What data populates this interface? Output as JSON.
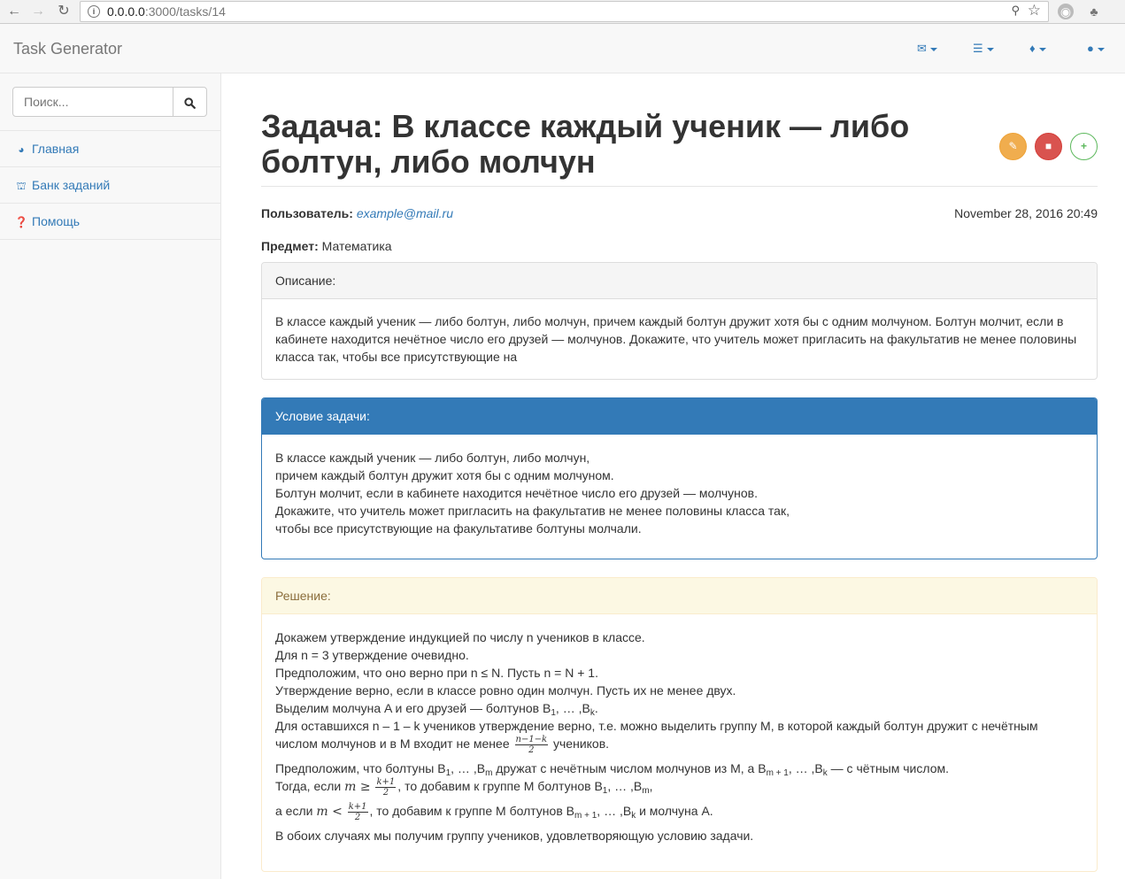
{
  "browser": {
    "url_host": "0.0.0.0",
    "url_path": ":3000/tasks/14"
  },
  "navbar": {
    "brand": "Task Generator",
    "icons": [
      "envelope-icon",
      "list-icon",
      "bell-icon",
      "user-icon"
    ]
  },
  "sidebar": {
    "search_placeholder": "Поиск...",
    "items": [
      {
        "label": "Главная",
        "icon": "dashboard-icon"
      },
      {
        "label": "Банк заданий",
        "icon": "bank-icon"
      },
      {
        "label": "Помощь",
        "icon": "question-icon"
      }
    ]
  },
  "task": {
    "title_prefix": "Задача:",
    "title": "В классе каждый ученик — либо болтун, либо молчун",
    "user_label": "Пользователь:",
    "user_email": "example@mail.ru",
    "date": "November 28, 2016 20:49",
    "subject_label": "Предмет:",
    "subject": "Математика",
    "description_header": "Описание:",
    "description": "В классе каждый ученик — либо болтун, либо молчун, причем каждый болтун дружит хотя бы с одним молчуном. Болтун молчит, если в кабинете находится нечётное число его друзей — молчунов. Докажите, что учитель может пригласить на факультатив не менее половины класса так, чтобы все присутствующие на",
    "condition_header": "Условие задачи:",
    "condition_lines": [
      "В классе каждый ученик — либо болтун, либо молчун,",
      "причем каждый болтун дружит хотя бы с одним молчуном.",
      "Болтун молчит, если в кабинете находится нечётное число его друзей — молчунов.",
      "Докажите, что учитель может пригласить на факультатив не менее половины класса так,",
      "чтобы все присутствующие на факультативе болтуны молчали."
    ],
    "solution_header": "Решение:",
    "solution": {
      "l1": "Докажем утверждение индукцией по числу n учеников в классе.",
      "l2": "Для n = 3 утверждение очевидно.",
      "l3": "Предположим, что оно верно при n ≤ N. Пусть n = N + 1.",
      "l4": "Утверждение верно, если в классе ровно один молчун. Пусть их не менее двух.",
      "l5a": "Выделим молчуна A и его друзей — болтунов B",
      "l5b": ", … ,B",
      "l5c": ".",
      "l6": "Для оставшихся n – 1 – k учеников утверждение верно, т.е. можно выделить группу M, в которой каждый болтун дружит с нечётным",
      "l7a": "числом молчунов и в M входит не менее",
      "l7frac_num": "n−1−k",
      "l7frac_den": "2",
      "l7b": "учеников.",
      "l8a": "Предположим, что болтуны B",
      "l8b": ", … ,B",
      "l8c": " дружат с нечётным числом молчунов из M, а B",
      "l8d": ", … ,B",
      "l8e": " — с чётным числом.",
      "l9a": "Тогда, если",
      "l9math": "m ≥",
      "l9frac_num": "k+1",
      "l9frac_den": "2",
      "l9b": ", то добавим к группе M болтунов B",
      "l9c": ", … ,B",
      "l9d": ",",
      "l10a": "а если",
      "l10math": "m <",
      "l10frac_num": "k+1",
      "l10frac_den": "2",
      "l10b": ", то добавим к группе M болтунов B",
      "l10c": ", … ,B",
      "l10d": " и молчуна A.",
      "l11": "В обоих случаях мы получим группу учеников, удовлетворяющую условию задачи.",
      "sub_1": "1",
      "sub_k": "k",
      "sub_m": "m",
      "sub_m1": "m + 1"
    }
  },
  "colors": {
    "primary": "#337ab7",
    "warning": "#f0ad4e",
    "danger": "#d9534f",
    "success": "#5cb85c"
  }
}
